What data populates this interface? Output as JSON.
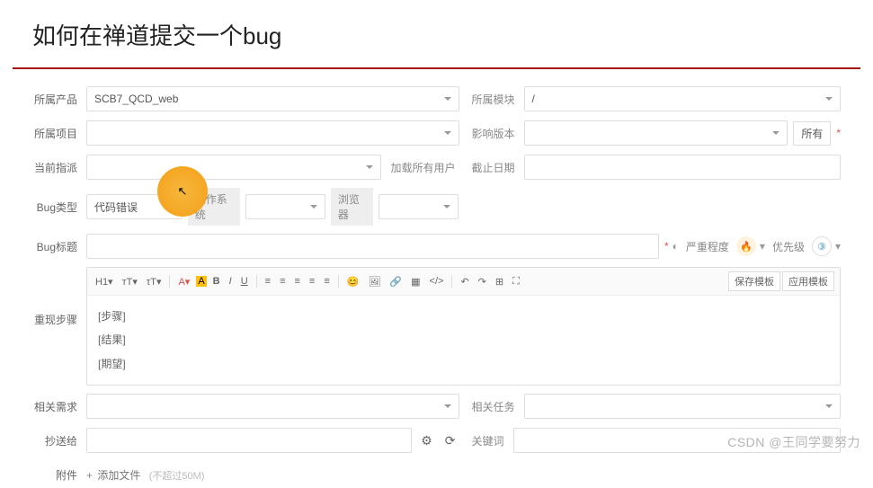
{
  "title": "如何在禅道提交一个bug",
  "labels": {
    "product": "所属产品",
    "module": "所属模块",
    "project": "所属项目",
    "version": "影响版本",
    "assignee": "当前指派",
    "loadAllUsers": "加载所有用户",
    "deadline": "截止日期",
    "bugType": "Bug类型",
    "os": "操作系统",
    "browser": "浏览器",
    "bugTitle": "Bug标题",
    "severity": "严重程度",
    "priority": "优先级",
    "steps": "重现步骤",
    "relatedStory": "相关需求",
    "relatedTask": "相关任务",
    "mailto": "抄送给",
    "keywords": "关键词",
    "attachment": "附件"
  },
  "values": {
    "product": "SCB7_QCD_web",
    "module": "/",
    "bugType": "代码错误",
    "all": "所有",
    "severityIcon": "🔥",
    "priorityNum": "③"
  },
  "editor": {
    "steps": "[步骤]",
    "result": "[结果]",
    "expect": "[期望]"
  },
  "toolbar": {
    "h1": "H1▾",
    "fontMinus": "ᴛT▾",
    "fontPlus": "τT▾",
    "fontColor": "A▾",
    "bgColor": "A",
    "bold": "B",
    "italic": "I",
    "underline": "U",
    "alignL": "≡",
    "alignC": "≡",
    "alignR": "≡",
    "ol": "≡",
    "ul": "≡",
    "emoji": "😊",
    "img": "🖼",
    "link": "🔗",
    "table": "▦",
    "code": "</>",
    "undo": "↶",
    "redo": "↷",
    "anchor": "⊞",
    "fullscreen": "⛶",
    "saveTpl": "保存模板",
    "applyTpl": "应用模板"
  },
  "attach": {
    "add": "添加文件",
    "hint": "(不超过50M)"
  },
  "icons": {
    "gear": "⚙",
    "refresh": "⟳",
    "star": "*",
    "plus": "+",
    "chevron": "▾"
  },
  "watermark": "CSDN @王同学要努力"
}
